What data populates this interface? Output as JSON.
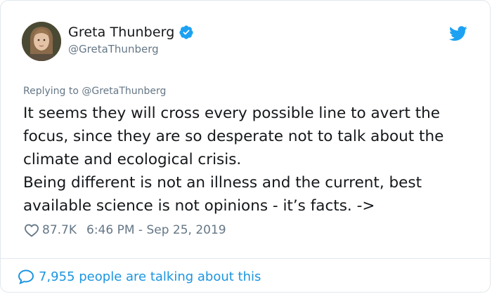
{
  "author": {
    "name": "Greta Thunberg",
    "handle": "@GretaThunberg",
    "verified_icon": "verified-badge-icon",
    "avatar_icon": "profile-photo"
  },
  "platform_icon": "twitter-bird-icon",
  "tweet": {
    "replying_to": "Replying to @GretaThunberg",
    "paragraphs": [
      "It seems they will cross every possible line to avert the focus, since they are so desperate not to talk about the climate and ecological crisis.",
      "Being different is not an illness and the current, best available science is not opinions - it’s facts. ->"
    ],
    "likes": "87.7K",
    "timestamp": "6:46 PM - Sep 25, 2019"
  },
  "footer": {
    "talking": "7,955 people are talking about this",
    "icon": "comment-bubble-icon"
  },
  "colors": {
    "accent": "#1da1f2",
    "link": "#1b95e0",
    "muted": "#657786",
    "text": "#14171a"
  }
}
